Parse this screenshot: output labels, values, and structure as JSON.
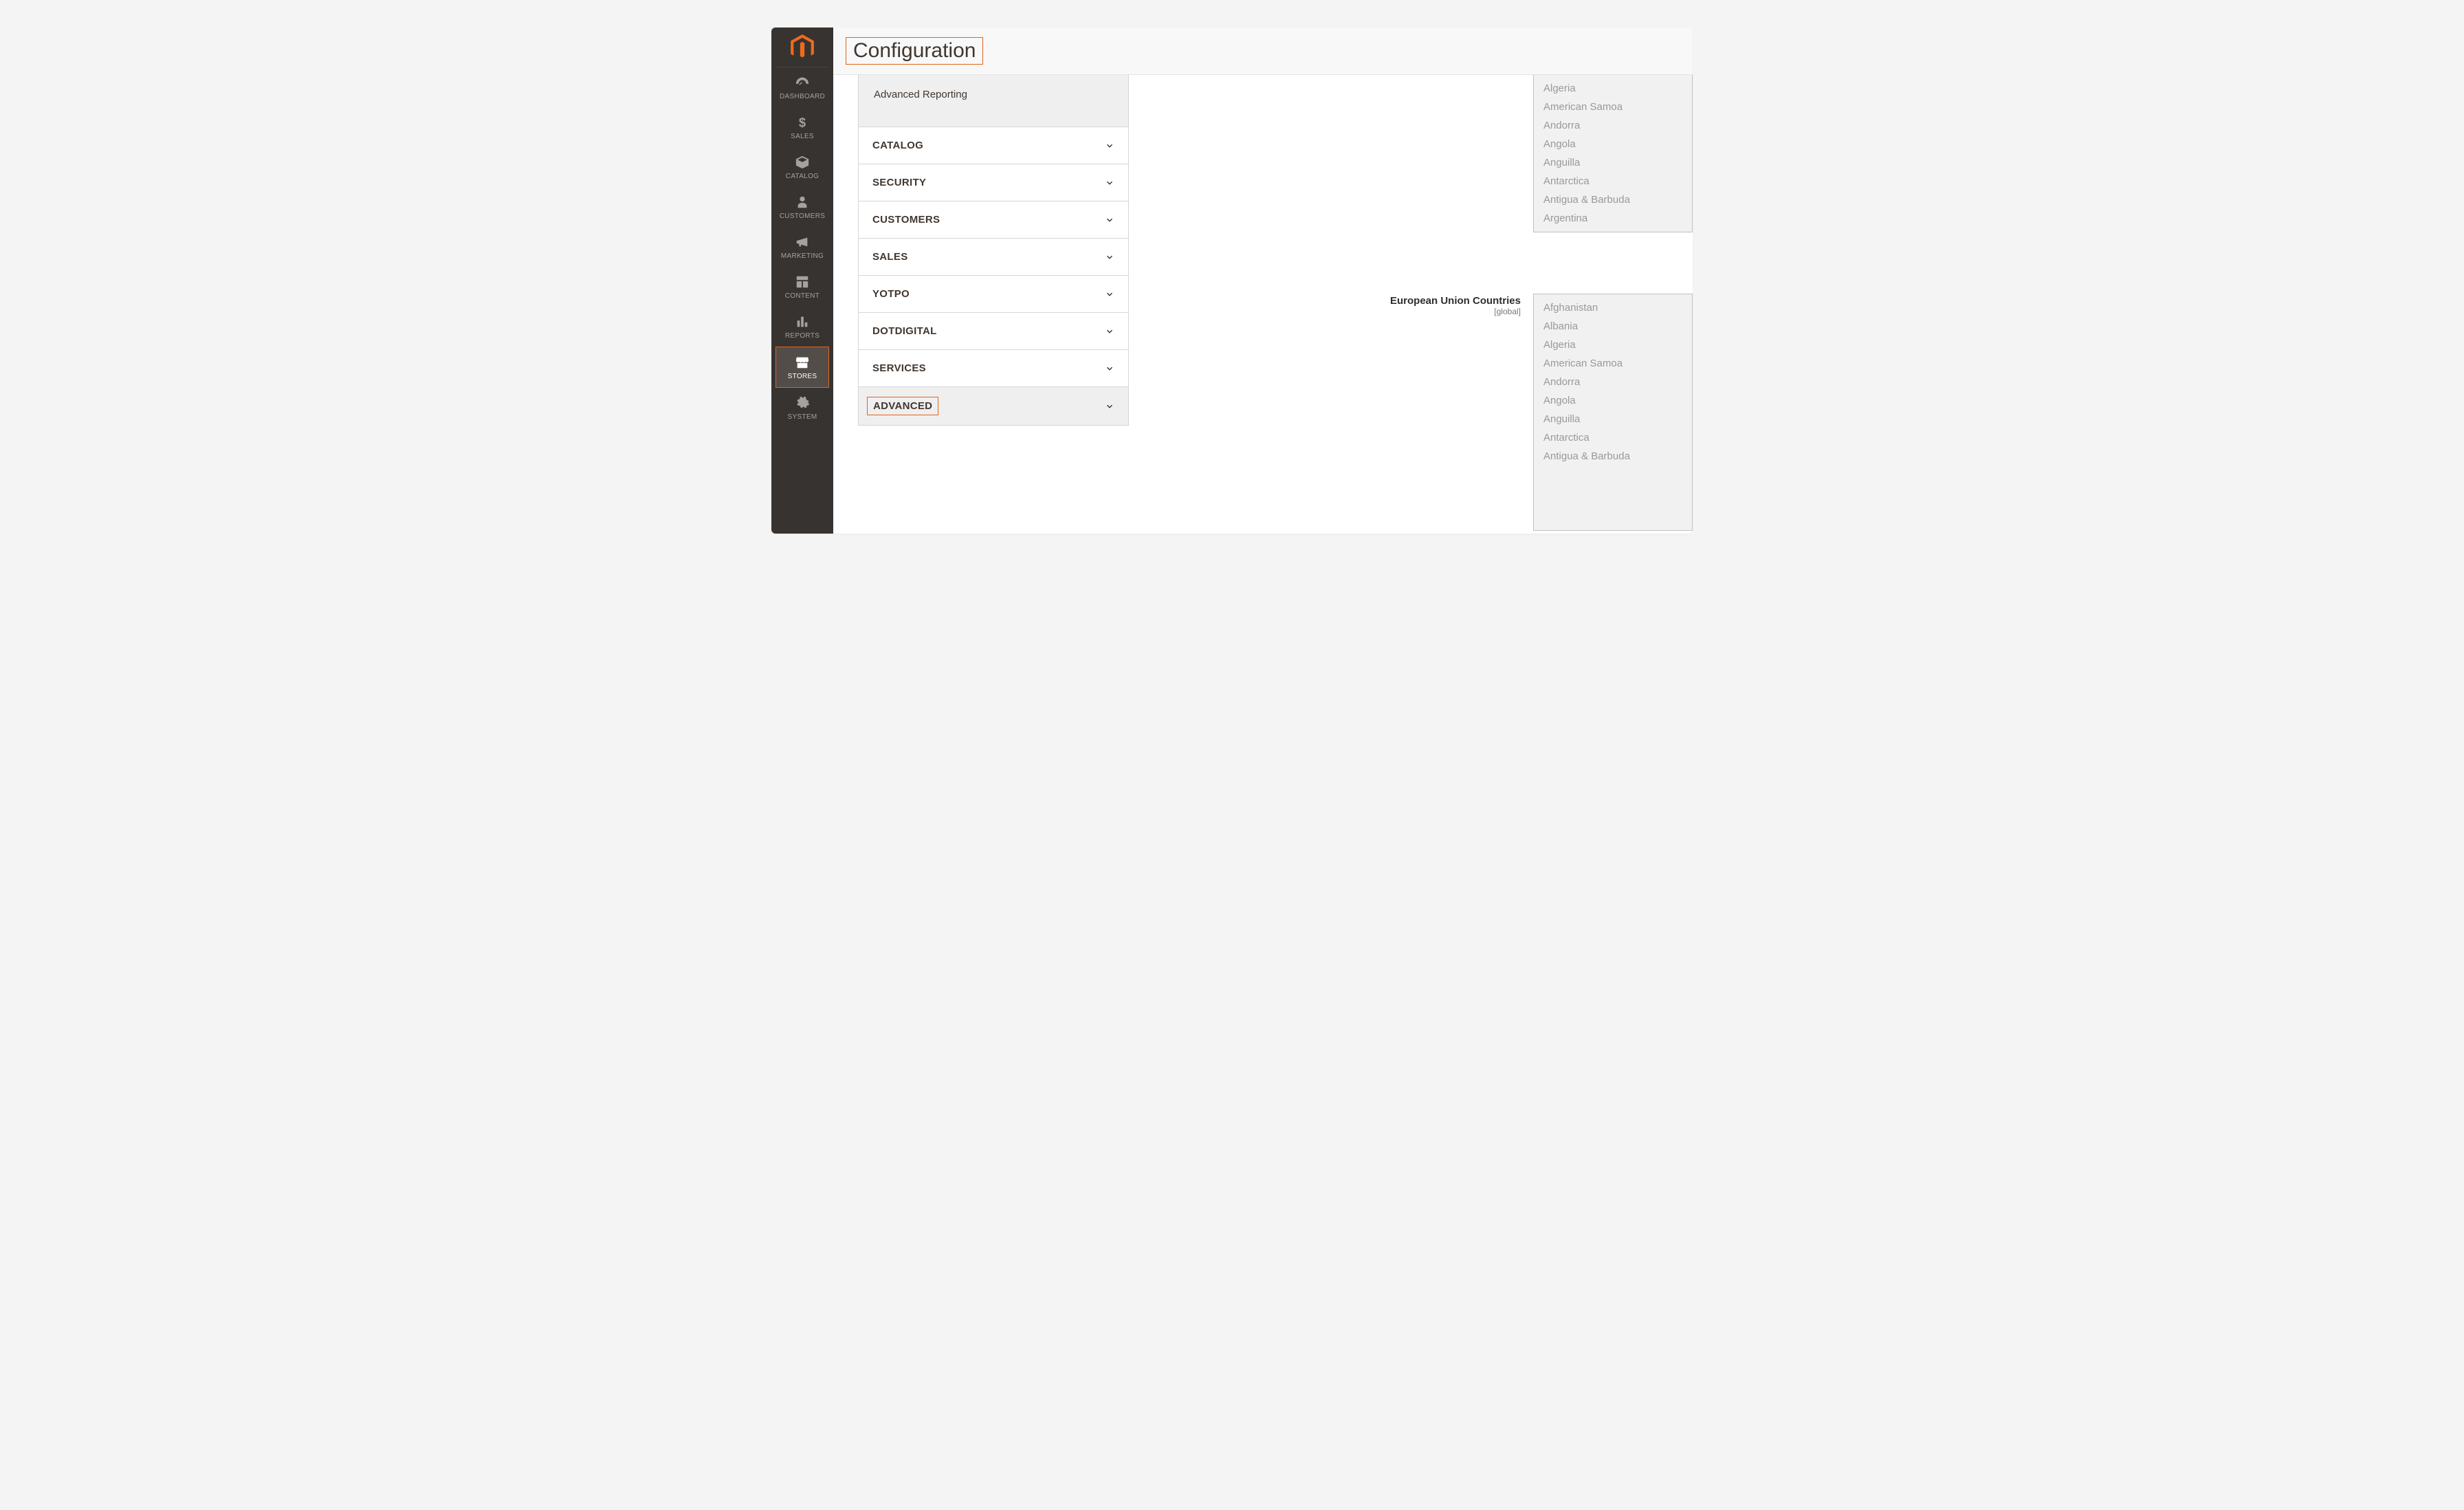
{
  "sidebar": {
    "items": [
      {
        "label": "DASHBOARD",
        "icon": "dashboard"
      },
      {
        "label": "SALES",
        "icon": "dollar"
      },
      {
        "label": "CATALOG",
        "icon": "box"
      },
      {
        "label": "CUSTOMERS",
        "icon": "person"
      },
      {
        "label": "MARKETING",
        "icon": "megaphone"
      },
      {
        "label": "CONTENT",
        "icon": "layout"
      },
      {
        "label": "REPORTS",
        "icon": "bars"
      },
      {
        "label": "STORES",
        "icon": "store",
        "active": true
      },
      {
        "label": "SYSTEM",
        "icon": "gear"
      }
    ]
  },
  "header": {
    "title": "Configuration"
  },
  "tabs": {
    "subitem": "Advanced Reporting",
    "groups": [
      {
        "label": "CATALOG"
      },
      {
        "label": "SECURITY"
      },
      {
        "label": "CUSTOMERS"
      },
      {
        "label": "SALES"
      },
      {
        "label": "YOTPO"
      },
      {
        "label": "DOTDIGITAL"
      },
      {
        "label": "SERVICES"
      },
      {
        "label": "ADVANCED",
        "selected": true
      }
    ]
  },
  "fields": {
    "top": {
      "options": [
        "Algeria",
        "American Samoa",
        "Andorra",
        "Angola",
        "Anguilla",
        "Antarctica",
        "Antigua & Barbuda",
        "Argentina"
      ]
    },
    "eu": {
      "label": "European Union Countries",
      "scope": "[global]",
      "options": [
        "Afghanistan",
        "Albania",
        "Algeria",
        "American Samoa",
        "Andorra",
        "Angola",
        "Anguilla",
        "Antarctica",
        "Antigua & Barbuda"
      ]
    }
  }
}
